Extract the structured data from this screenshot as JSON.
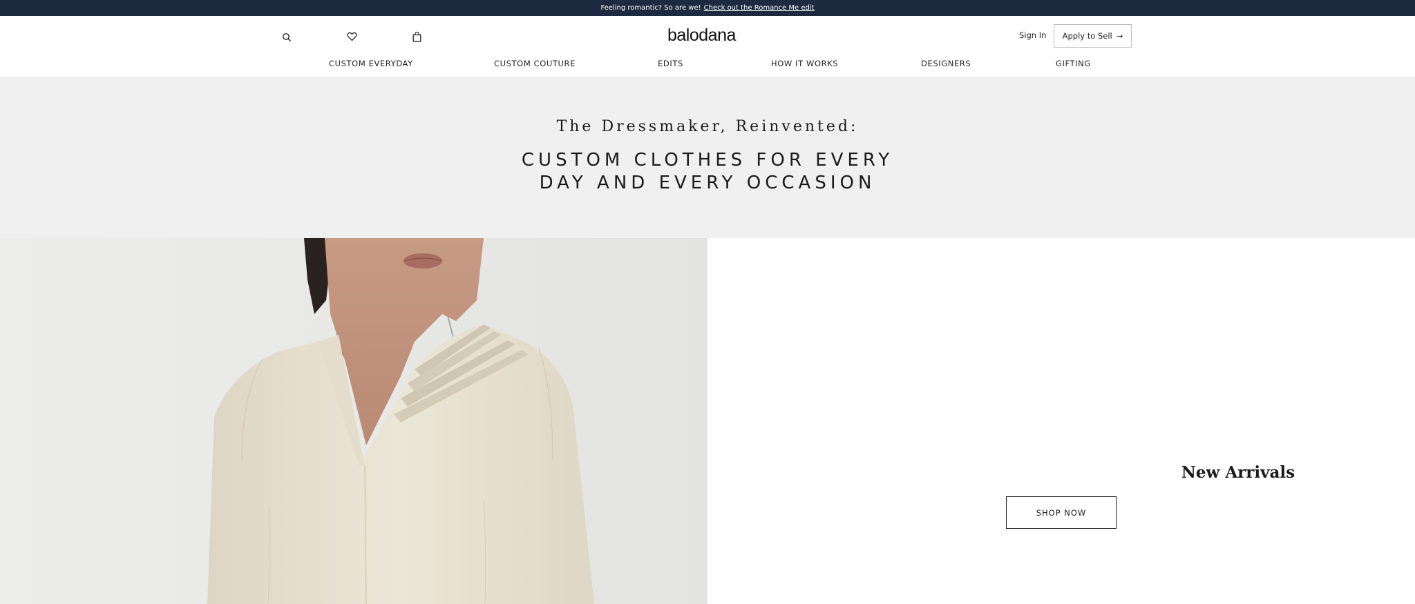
{
  "announcement": {
    "text": "Feeling romantic? So are we!",
    "link": "Check out the Romance Me edit"
  },
  "header": {
    "logo": "balodana",
    "icons": [
      "search-icon",
      "heart-icon",
      "bag-icon"
    ],
    "sign_in": "Sign In",
    "apply_to_sell": "Apply to Sell",
    "apply_arrow": "→"
  },
  "nav": {
    "items": [
      "CUSTOM EVERYDAY",
      "CUSTOM COUTURE",
      "EDITS",
      "HOW IT WORKS",
      "DESIGNERS",
      "GIFTING"
    ]
  },
  "hero": {
    "tagline": "The Dressmaker, Reinvented:",
    "headline_line1": "CUSTOM CLOTHES FOR EVERY",
    "headline_line2": "DAY AND EVERY OCCASION"
  },
  "promo": {
    "title": "New Arrivals",
    "cta": "SHOP NOW"
  },
  "colors": {
    "announcement_bg": "#1e2a3f",
    "hero_band_bg": "#f0f0f0",
    "garment": "#ece6d6",
    "photo_bg": "#e8e8e6"
  }
}
